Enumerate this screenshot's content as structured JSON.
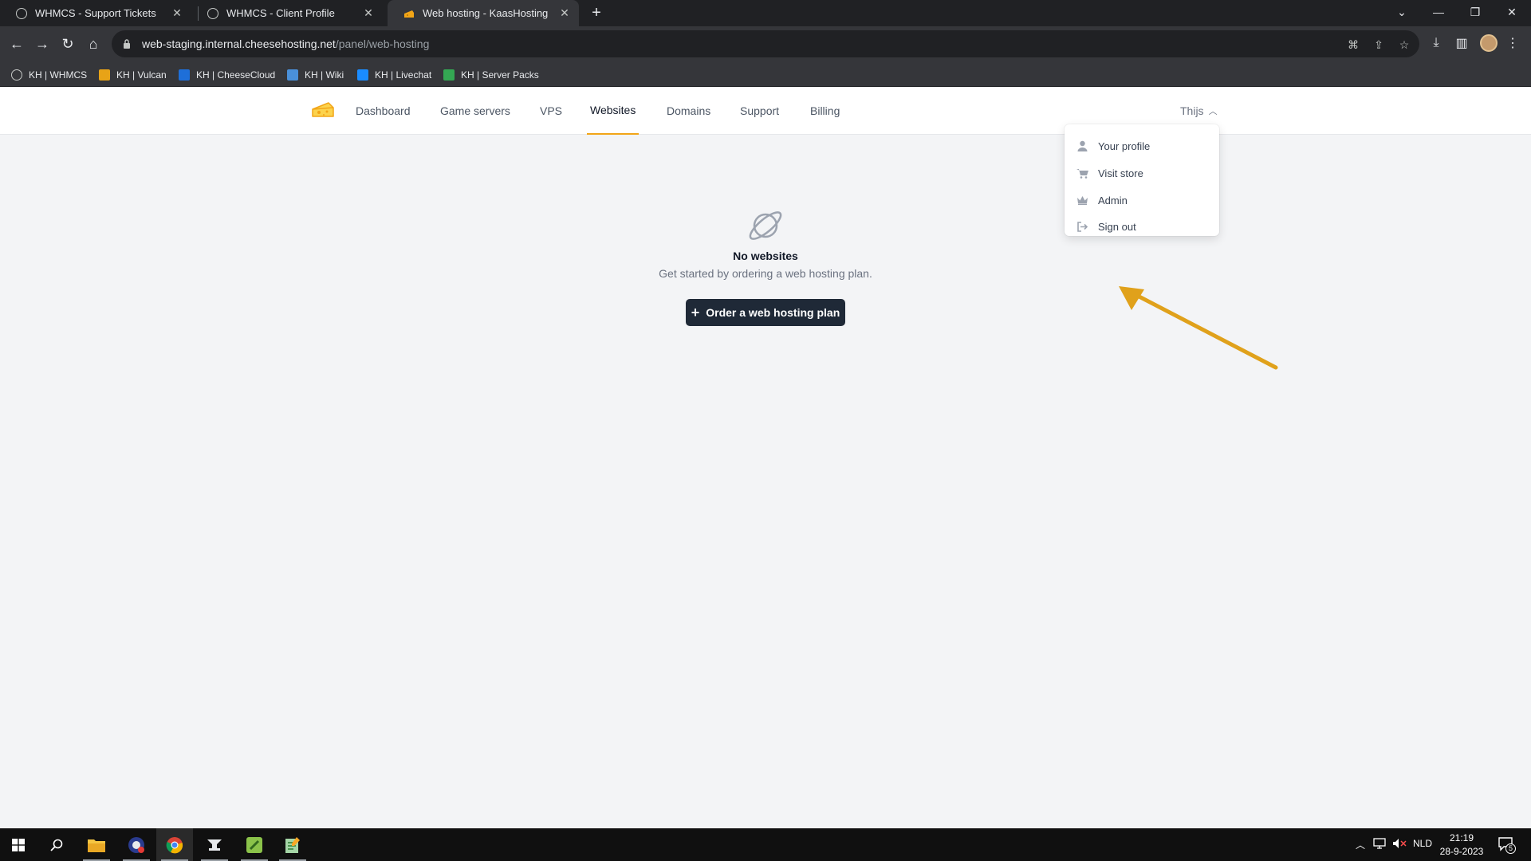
{
  "browser": {
    "tabs": [
      {
        "title": "WHMCS - Support Tickets",
        "icon": "globe-icon"
      },
      {
        "title": "WHMCS - Client Profile",
        "icon": "globe-icon"
      },
      {
        "title": "Web hosting - KaasHosting",
        "icon": "cheese-icon",
        "active": true
      }
    ],
    "new_tab": "+",
    "url_host": "web-staging.internal.cheesehosting.net",
    "url_path": "/panel/web-hosting",
    "bookmarks": [
      {
        "label": "KH | WHMCS",
        "color": "#9aa0a6"
      },
      {
        "label": "KH | Vulcan",
        "color": "#e8a317"
      },
      {
        "label": "KH | CheeseCloud",
        "color": "#1e6fd9"
      },
      {
        "label": "KH | Wiki",
        "color": "#4a90d9"
      },
      {
        "label": "KH | Livechat",
        "color": "#1a8cff"
      },
      {
        "label": "KH | Server Packs",
        "color": "#34a853"
      }
    ]
  },
  "site": {
    "nav": [
      {
        "label": "Dashboard"
      },
      {
        "label": "Game servers"
      },
      {
        "label": "VPS"
      },
      {
        "label": "Websites",
        "active": true
      },
      {
        "label": "Domains"
      },
      {
        "label": "Support"
      },
      {
        "label": "Billing"
      }
    ],
    "user_name": "Thijs",
    "accent_color": "#f2a517",
    "user_menu": [
      {
        "label": "Your profile",
        "icon": "user-icon"
      },
      {
        "label": "Visit store",
        "icon": "cart-icon"
      },
      {
        "label": "Admin",
        "icon": "crown-icon"
      },
      {
        "label": "Sign out",
        "icon": "sign-out-icon"
      }
    ],
    "empty_state": {
      "icon": "planet-icon",
      "title": "No websites",
      "subtitle": "Get started by ordering a web hosting plan.",
      "button_label": "Order a web hosting plan"
    }
  },
  "annotation": {
    "type": "arrow",
    "color": "#e0a11b",
    "points_to": "Admin"
  },
  "taskbar": {
    "language": "NLD",
    "time": "21:19",
    "date": "28-9-2023",
    "notification_count": "5"
  }
}
